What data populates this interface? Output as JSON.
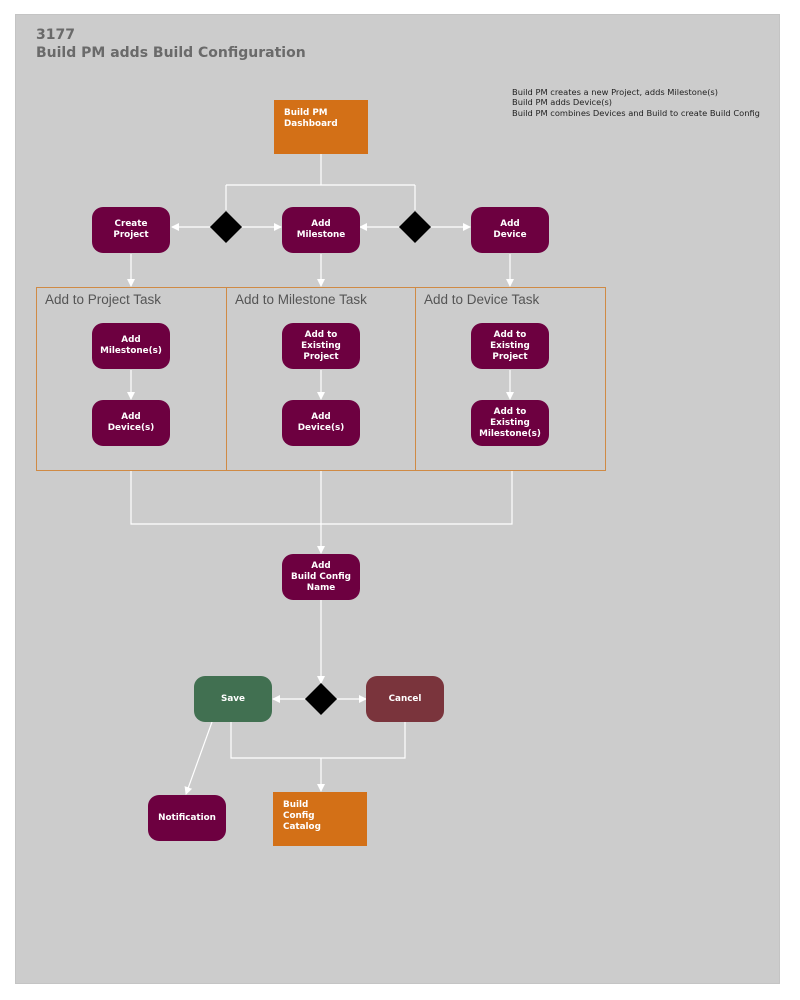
{
  "diagram": {
    "id": "3177",
    "title": "Build PM adds Build Configuration",
    "notes": [
      "Build PM creates a new Project, adds Milestone(s)",
      "Build PM adds Device(s)",
      "Build PM combines Devices and Build to create Build Config"
    ],
    "colors": {
      "background": "#cccccc",
      "process": "#6d0040",
      "terminal": "#d37017",
      "save": "#417051",
      "cancel": "#7a343c",
      "decision": "#000000",
      "connector": "#ffffff",
      "lane_border": "#cf8a45"
    },
    "nodes": {
      "dashboard": "Build PM\nDashboard",
      "create_project": "Create\nProject",
      "add_milestone": "Add\nMilestone",
      "add_device": "Add\nDevice",
      "p_add_milestones": "Add\nMilestone(s)",
      "p_add_devices": "Add\nDevice(s)",
      "m_add_existing_project": "Add to\nExisting\nProject",
      "m_add_devices": "Add\nDevice(s)",
      "d_add_existing_project": "Add to\nExisting\nProject",
      "d_add_existing_milestones": "Add to\nExisting\nMilestone(s)",
      "add_config_name": "Add\nBuild Config\nName",
      "save": "Save",
      "cancel": "Cancel",
      "notification": "Notification",
      "catalog": "Build\nConfig\nCatalog"
    },
    "lanes": [
      {
        "title": "Add to Project Task"
      },
      {
        "title": "Add to Milestone Task"
      },
      {
        "title": "Add to Device Task"
      }
    ]
  }
}
